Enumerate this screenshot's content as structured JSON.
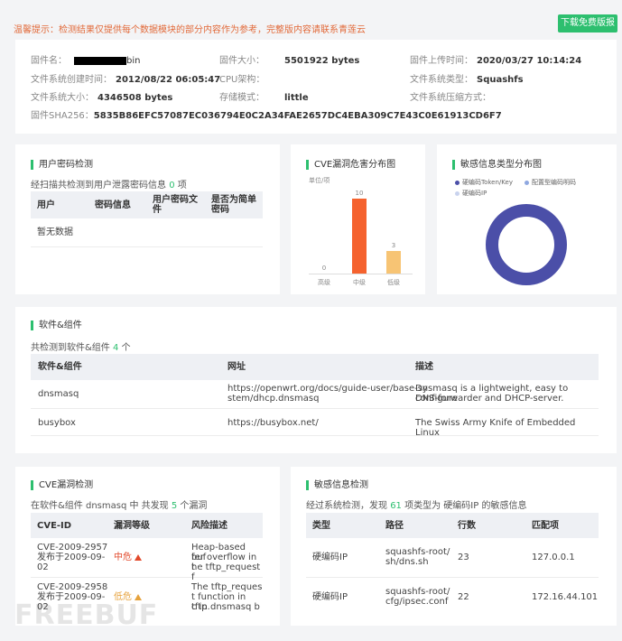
{
  "notice": "温馨提示：检测结果仅提供每个数据模块的部分内容作为参考，完整版内容请联系青莲云",
  "download_label": "下载免费版报",
  "info": {
    "fw_name_label": "固件名：",
    "fw_name_suffix": "bin",
    "fw_size_label": "固件大小：",
    "fw_size": "5501922 bytes",
    "upload_time_label": "固件上传时间：",
    "upload_time": "2020/03/27 10:14:24",
    "fs_created_label": "文件系统创建时间：",
    "fs_created": "2012/08/22 06:05:47",
    "cpu_label": "CPU架构：",
    "cpu": "",
    "fs_type_label": "文件系统类型：",
    "fs_type": "Squashfs",
    "fs_size_label": "文件系统大小：",
    "fs_size": "4346508 bytes",
    "endian_label": "存储模式：",
    "endian": "little",
    "compress_label": "文件系统压缩方式：",
    "compress": "",
    "sha_label": "固件SHA256：",
    "sha": "5835B86EFC57087EC036794E0C2A34FAE2657DC4EBA309C7E43C0E61913CD6F7"
  },
  "pwd": {
    "title": "用户密码检测",
    "sub_prefix": "经扫描共检测到用户泄露密码信息",
    "count": "0",
    "sub_suffix": "项",
    "cols": [
      "用户",
      "密码信息",
      "用户密码文件",
      "是否为简单密码"
    ],
    "empty": "暂无数据"
  },
  "cve_chart": {
    "title": "CVE漏洞危害分布图",
    "unit": "单位/项"
  },
  "chart_data": {
    "type": "bar",
    "categories": [
      "高级",
      "中级",
      "低级"
    ],
    "values": [
      0,
      10,
      3
    ],
    "title": "CVE漏洞危害分布图",
    "ylabel": "单位/项",
    "colors": [
      "#f5622e",
      "#f5622e",
      "#f7c474"
    ],
    "ylim": [
      0,
      10
    ]
  },
  "sens_chart": {
    "title": "敏感信息类型分布图",
    "legend": [
      {
        "label": "硬编码Token/Key",
        "color": "#4b4fa8"
      },
      {
        "label": "配置型编码明码",
        "color": "#8fa8e0"
      },
      {
        "label": "硬编码IP",
        "color": "#c9d3ee"
      }
    ],
    "ring_color": "#4b4fa8"
  },
  "components": {
    "title": "软件&组件",
    "sub_prefix": "共检测到软件&组件",
    "count": "4",
    "sub_suffix": "个",
    "cols": [
      "软件&组件",
      "网址",
      "描述"
    ],
    "rows": [
      {
        "name": "dnsmasq",
        "url_1": "https://openwrt.org/docs/guide-user/base-sy",
        "url_2": "stem/dhcp.dnsmasq",
        "desc_1": "Dnsmasq is a lightweight, easy to configure",
        "desc_2": "DNS-forwarder and DHCP-server."
      },
      {
        "name": "busybox",
        "url_1": "https://busybox.net/",
        "url_2": "",
        "desc_1": "The Swiss Army Knife of Embedded Linux",
        "desc_2": ""
      }
    ]
  },
  "cve": {
    "title": "CVE漏洞检测",
    "sub_prefix": "在软件&组件 dnsmasq 中 共发现",
    "count": "5",
    "sub_suffix": "个漏洞",
    "cols": [
      "CVE-ID",
      "漏洞等级",
      "风险描述"
    ],
    "rows": [
      {
        "id": "CVE-2009-2957",
        "date_1": "发布于2009-09-",
        "date_2": "02",
        "level": "中危",
        "desc": [
          "Heap-based buf",
          "fer overflow in t",
          "he tftp_request f"
        ]
      },
      {
        "id": "CVE-2009-2958",
        "date_1": "发布于2009-09-",
        "date_2": "02",
        "level": "低危",
        "desc": [
          "The tftp_reques",
          "t function in tftp.",
          "c in dnsmasq b"
        ]
      }
    ]
  },
  "sensitive": {
    "title": "敏感信息检测",
    "sub_prefix": "经过系统检测，发现",
    "count": "61",
    "sub_suffix": "项类型为 硬编码IP 的敏感信息",
    "cols": [
      "类型",
      "路径",
      "行数",
      "匹配项"
    ],
    "rows": [
      {
        "type": "硬编码IP",
        "path_1": "squashfs-root/",
        "path_2": "sh/dns.sh",
        "line": "23",
        "match": "127.0.0.1"
      },
      {
        "type": "硬编码IP",
        "path_1": "squashfs-root/",
        "path_2": "cfg/ipsec.conf",
        "line": "22",
        "match": "172.16.44.101"
      }
    ]
  },
  "watermark": "FREEBUF"
}
